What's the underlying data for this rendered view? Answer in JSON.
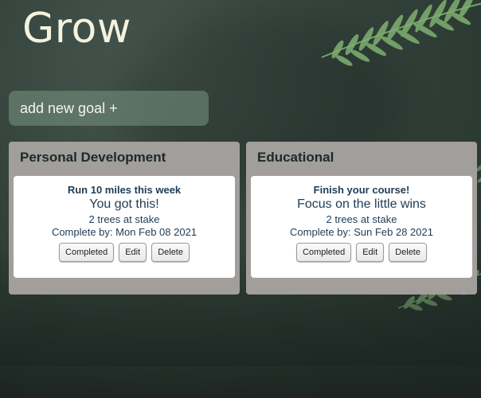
{
  "app": {
    "title": "Grow"
  },
  "add_goal": {
    "label": "add new goal +"
  },
  "categories": [
    {
      "title": "Personal Development",
      "goal": {
        "name": "Run 10 miles this week",
        "motto": "You got this!",
        "stake": "2 trees at stake",
        "due": "Complete by: Mon Feb 08 2021"
      }
    },
    {
      "title": "Educational",
      "goal": {
        "name": "Finish your course!",
        "motto": "Focus on the little wins",
        "stake": "2 trees at stake",
        "due": "Complete by: Sun Feb 28 2021"
      }
    }
  ],
  "buttons": {
    "completed": "Completed",
    "edit": "Edit",
    "delete": "Delete"
  },
  "colors": {
    "title": "#f3f3df",
    "category_bg": "#a29e9c",
    "card_text": "#1f3c55",
    "add_goal_bg": "#6f8f7c",
    "fern": "#7fb071"
  },
  "icons": [
    "fern-leaf-icon"
  ]
}
